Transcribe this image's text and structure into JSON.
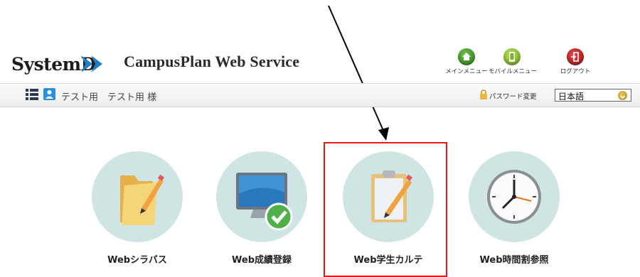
{
  "header": {
    "logo_text": "SystemD",
    "app_title": "CampusPlan Web Service",
    "buttons": [
      {
        "label": "メインメニュー",
        "icon": "home-icon"
      },
      {
        "label": "モバイルメニュー",
        "icon": "mobile-icon"
      },
      {
        "label": "ログアウト",
        "icon": "logout-icon"
      }
    ]
  },
  "userbar": {
    "user_name": "テスト用　テスト用 様",
    "password_link": "パスワード変更",
    "language": "日本語"
  },
  "tiles": [
    {
      "label": "Webシラバス",
      "icon": "folder-pencil-icon"
    },
    {
      "label": "Web成績登録",
      "icon": "monitor-check-icon"
    },
    {
      "label": "Web学生カルテ",
      "icon": "clipboard-pencil-icon"
    },
    {
      "label": "Web時間割参照",
      "icon": "clock-icon"
    }
  ],
  "colors": {
    "tile_circle": "#cfe5e3",
    "highlight": "#e21a1a",
    "user_icon": "#2d8fd5"
  }
}
